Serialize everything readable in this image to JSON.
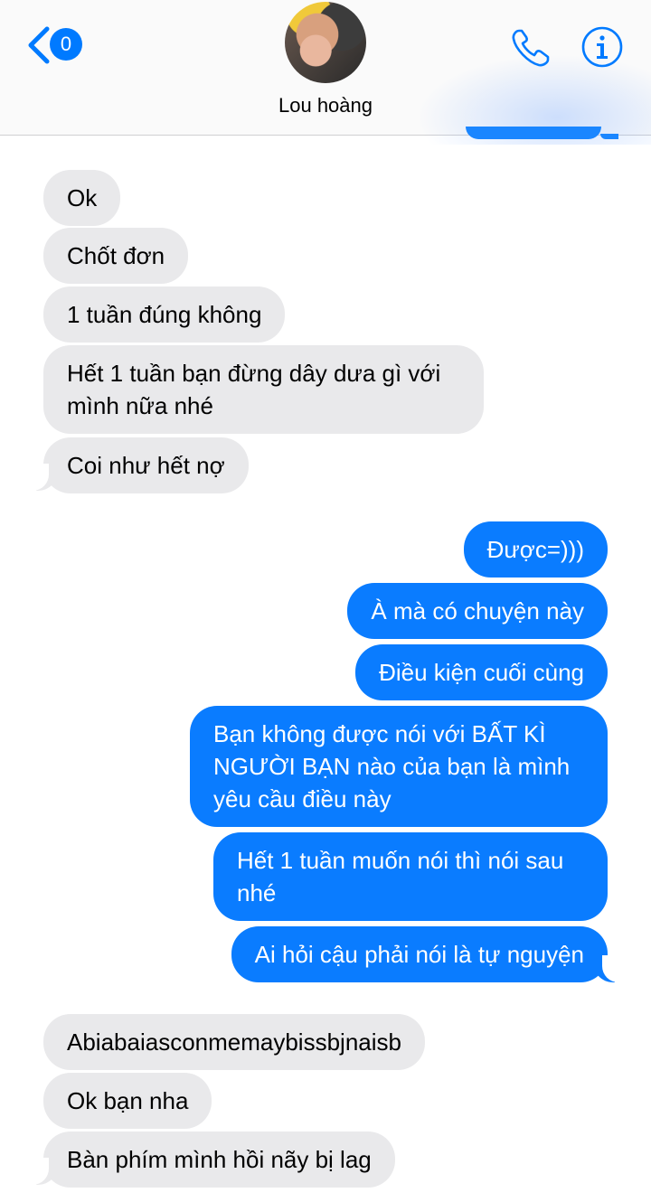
{
  "header": {
    "back_badge": "0",
    "contact_name": "Lou hoàng"
  },
  "icons": {
    "back": "chevron-left-icon",
    "call": "phone-icon",
    "info": "info-icon"
  },
  "colors": {
    "accent": "#007aff",
    "outgoing_bubble": "#0a7cff",
    "incoming_bubble": "#e9e9eb"
  },
  "messages": {
    "group1": [
      {
        "text": "Ok"
      },
      {
        "text": "Chốt đơn"
      },
      {
        "text": "1 tuần đúng không"
      },
      {
        "text": "Hết 1 tuần bạn đừng dây dưa gì với mình nữa nhé"
      },
      {
        "text": "Coi như hết nợ"
      }
    ],
    "group2": [
      {
        "text": "Được=)))"
      },
      {
        "text": "À mà có chuyện này"
      },
      {
        "text": "Điều kiện cuối cùng"
      },
      {
        "text": "Bạn không được nói với BẤT KÌ NGƯỜI BẠN nào của bạn là mình yêu cầu điều này"
      },
      {
        "text": "Hết 1 tuần muốn nói thì nói sau nhé"
      },
      {
        "text": "Ai hỏi cậu phải nói là tự nguyện"
      }
    ],
    "group3": [
      {
        "text": "Abiabaiasconmemaybissbjnaisb"
      },
      {
        "text": "Ok bạn nha"
      },
      {
        "text": "Bàn phím mình hồi nãy bị lag"
      }
    ]
  }
}
